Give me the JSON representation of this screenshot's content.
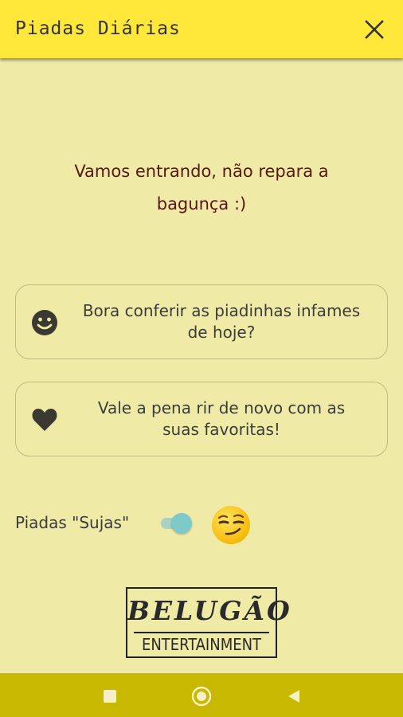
{
  "appbar": {
    "title": "Piadas Diárias"
  },
  "welcome": {
    "line1": "Vamos entrando, não repara a",
    "line2": "bagunça :)"
  },
  "cards": [
    {
      "icon": "smiley-icon",
      "line1": "Bora conferir as piadinhas infames",
      "line2": "de hoje?"
    },
    {
      "icon": "heart-icon",
      "line1": "Vale a pena rir de novo com as",
      "line2": "suas favoritas!"
    }
  ],
  "dirty_toggle": {
    "label": "Piadas \"Sujas\"",
    "checked": true
  },
  "logo": {
    "top": "BELUGÃO",
    "bottom": "ENTERTAINMENT"
  },
  "colors": {
    "background": "#efeaa6",
    "appbar": "#ffe83a",
    "navbar": "#c8b800",
    "welcome_text": "#5a1616",
    "switch_thumb": "#7ec9c9"
  },
  "navbar": {
    "icons": [
      "recents-square-icon",
      "home-circle-icon",
      "back-triangle-icon"
    ]
  }
}
